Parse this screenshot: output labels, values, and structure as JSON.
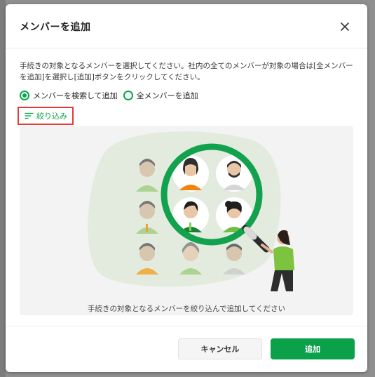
{
  "dialog": {
    "title": "メンバーを追加",
    "description": "手続きの対象となるメンバーを選択してください。社内の全てのメンバーが対象の場合は[全メンバーを追加]を選択し[追加]ボタンをクリックしてください。"
  },
  "radio_options": [
    {
      "label": "メンバーを検索して追加",
      "selected": true
    },
    {
      "label": "全メンバーを追加",
      "selected": false
    }
  ],
  "filter": {
    "label": "絞り込み"
  },
  "illustration": {
    "caption": "手続きの対象となるメンバーを絞り込んで追加してください"
  },
  "footer": {
    "cancel_label": "キャンセル",
    "add_label": "追加"
  },
  "colors": {
    "accent": "#0ba14b",
    "highlight_border": "#e53935"
  },
  "icons": {
    "close": "close-icon",
    "filter": "filter-lines-icon"
  }
}
